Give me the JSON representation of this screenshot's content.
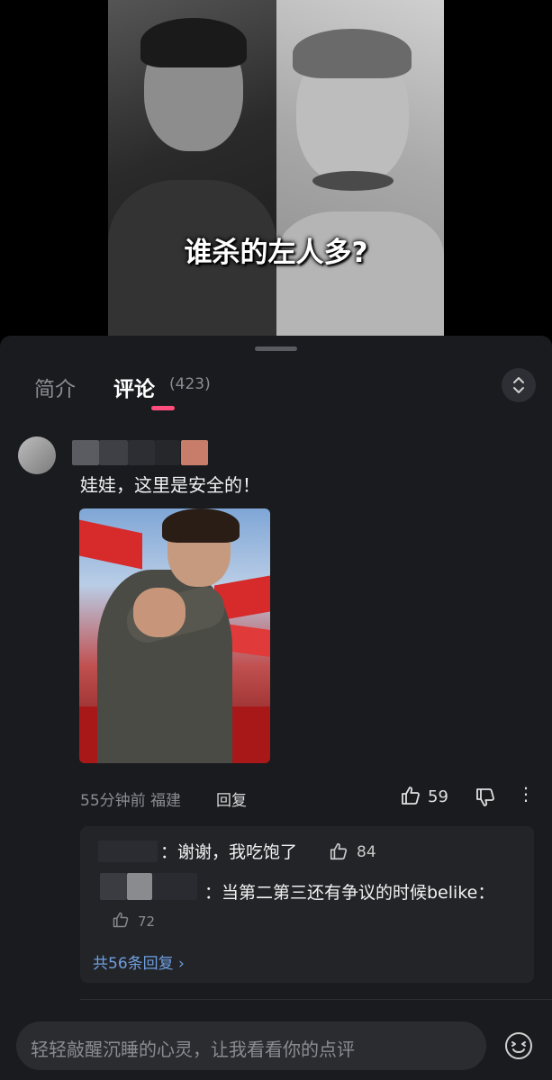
{
  "video": {
    "caption": "谁杀的左人多?"
  },
  "tabs": {
    "intro_label": "简介",
    "comments_label": "评论",
    "comments_count": "(423)"
  },
  "comment": {
    "text": "娃娃，这里是安全的！",
    "time_location": "55分钟前 福建",
    "reply_label": "回复",
    "like_count": "59"
  },
  "replies": [
    {
      "text": "：谢谢，我吃饱了",
      "like_count": "84"
    },
    {
      "text": "：当第二第三还有争议的时候belike：",
      "like_count": "72"
    }
  ],
  "more_replies_label": "共56条回复 ›",
  "input": {
    "placeholder": "轻轻敲醒沉睡的心灵，让我看看你的点评"
  },
  "colors": {
    "accent": "#ff4d7d",
    "link": "#6f9fe0",
    "sheet_bg": "#1a1b1f"
  }
}
